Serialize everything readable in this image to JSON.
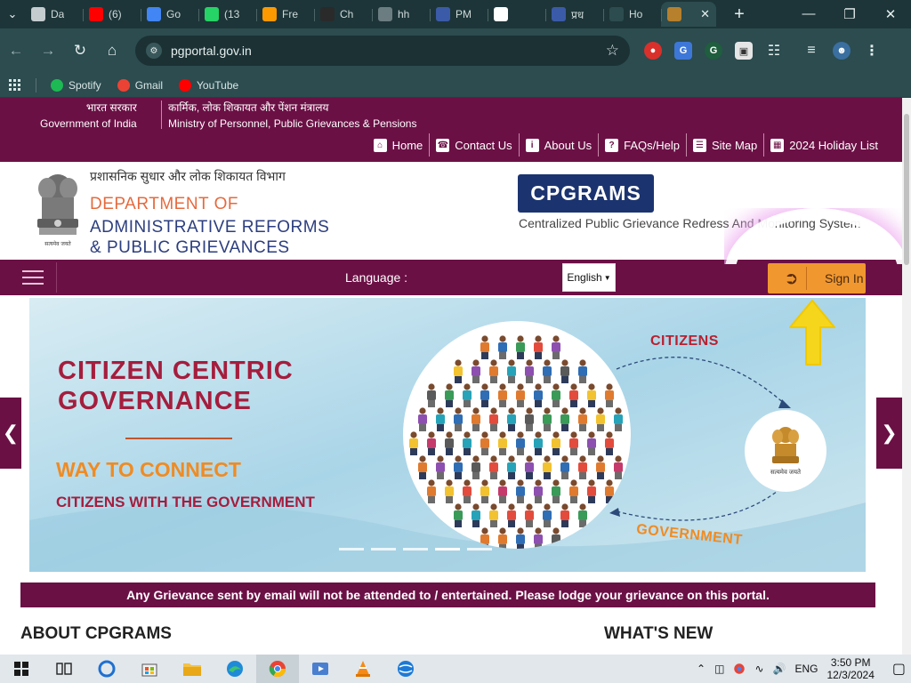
{
  "browser": {
    "tabs": [
      {
        "title": "Da",
        "favicon": "doc-icon",
        "color": "#c4ccd0",
        "active": false
      },
      {
        "title": "(6)",
        "favicon": "youtube-icon",
        "color": "#ff0000",
        "active": false
      },
      {
        "title": "Go",
        "favicon": "docs-icon",
        "color": "#4285f4",
        "active": false
      },
      {
        "title": "(13",
        "favicon": "whatsapp-icon",
        "color": "#25d366",
        "active": false
      },
      {
        "title": "Fre",
        "favicon": "amazon-icon",
        "color": "#ff9900",
        "active": false
      },
      {
        "title": "Ch",
        "favicon": "chatgpt-icon",
        "color": "#2a2a2a",
        "active": false
      },
      {
        "title": "hh",
        "favicon": "globe-icon",
        "color": "#6b7d80",
        "active": false
      },
      {
        "title": "PM",
        "favicon": "pib-icon",
        "color": "#3b5ba8",
        "active": false
      },
      {
        "title": "",
        "favicon": "google-icon",
        "color": "#ffffff",
        "active": false
      },
      {
        "title": "प्रध",
        "favicon": "pib-icon",
        "color": "#3b5ba8",
        "active": false
      },
      {
        "title": "Ho",
        "favicon": "figure-icon",
        "color": "#2c4c4f",
        "active": false
      },
      {
        "title": "",
        "favicon": "emblem-icon",
        "color": "#b7802c",
        "active": true
      }
    ],
    "url": "pgportal.gov.in",
    "bookmarks": [
      {
        "label": "Spotify",
        "color": "#1db954"
      },
      {
        "label": "Gmail",
        "color": "#ea4335"
      },
      {
        "label": "YouTube",
        "color": "#ff0000"
      }
    ]
  },
  "page": {
    "gov_top": {
      "left_hindi": "भारत सरकार",
      "left_english": "Government of India",
      "right_hindi": "कार्मिक, लोक शिकायत और पेंशन मंत्रालय",
      "right_english": "Ministry of Personnel, Public Grievances & Pensions"
    },
    "top_links": [
      {
        "label": "Home",
        "icon": "home-icon"
      },
      {
        "label": "Contact Us",
        "icon": "phone-icon"
      },
      {
        "label": "About Us",
        "icon": "info-icon"
      },
      {
        "label": "FAQs/Help",
        "icon": "help-icon"
      },
      {
        "label": "Site Map",
        "icon": "sitemap-icon"
      },
      {
        "label": "2024 Holiday List",
        "icon": "calendar-icon"
      }
    ],
    "dept": {
      "hindi": "प्रशासनिक सुधार और लोक शिकायत विभाग",
      "line1": "DEPARTMENT OF",
      "line2": "ADMINISTRATIVE REFORMS",
      "line3": "& PUBLIC GRIEVANCES"
    },
    "cpgrams": {
      "badge": "CPGRAMS",
      "subtitle": "Centralized Public Grievance Redress And Monitoring System"
    },
    "nav": {
      "language_label": "Language :",
      "language_value": "English",
      "signin_label": "Sign In"
    },
    "banner": {
      "title_1": "CITIZEN  CENTRIC",
      "title_2": "GOVERNANCE",
      "tag_1": "WAY TO CONNECT",
      "tag_2": "CITIZENS WITH THE GOVERNMENT",
      "citizens_label": "CITIZENS",
      "government_label": "GOVERNMENT",
      "emblem_caption": "सत्यमेव जयते"
    },
    "notice": "Any Grievance sent by email will not be attended to / entertained. Please lodge your grievance on this portal.",
    "section_about": "ABOUT CPGRAMS",
    "section_new": "WHAT'S NEW"
  },
  "taskbar": {
    "language": "ENG",
    "time": "3:50 PM",
    "date": "12/3/2024"
  }
}
